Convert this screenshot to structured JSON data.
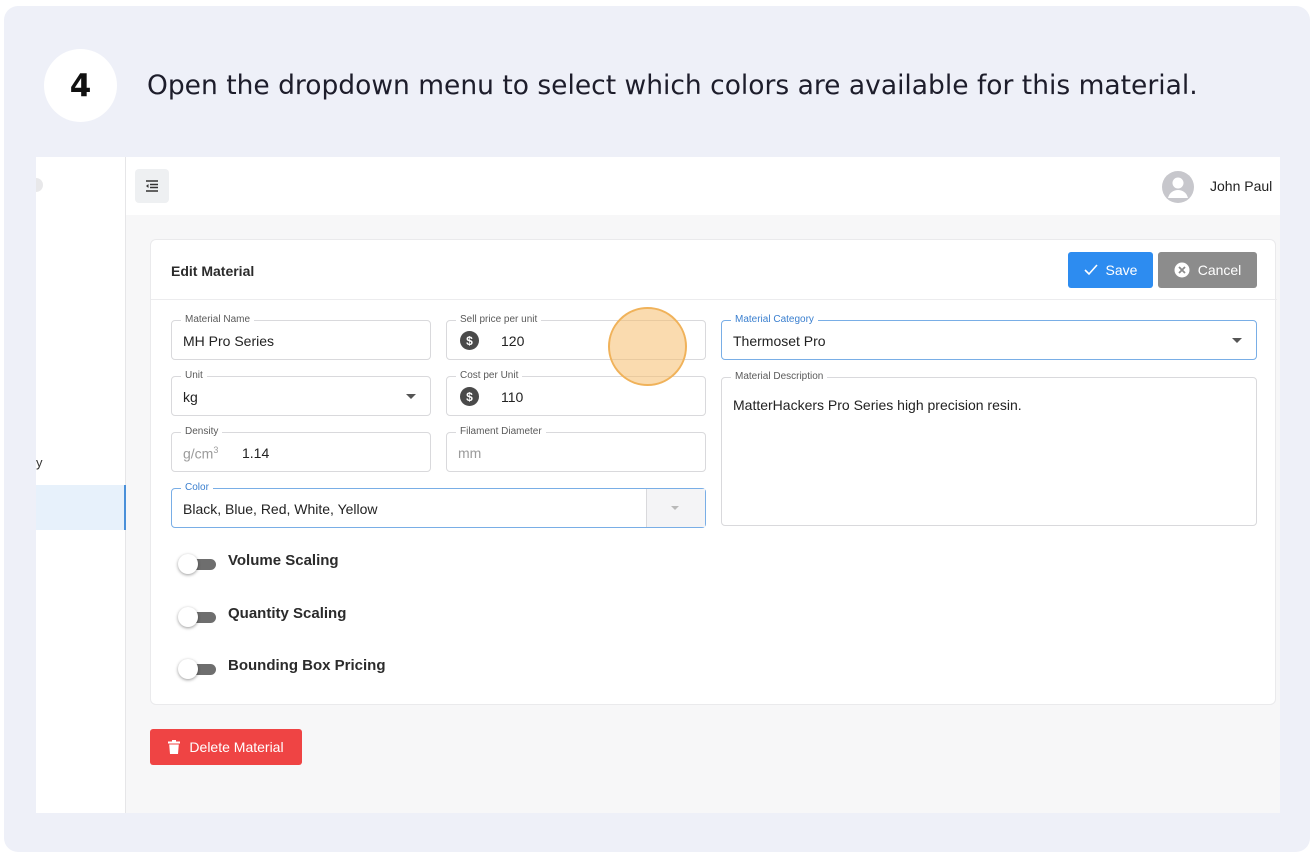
{
  "step": {
    "number": "4",
    "instruction": "Open the dropdown menu to select which colors are available for this material."
  },
  "sidebar": {
    "fragment_text": "y"
  },
  "topbar": {
    "user_name": "John Paul"
  },
  "card": {
    "title": "Edit Material",
    "save_label": "Save",
    "cancel_label": "Cancel"
  },
  "form": {
    "material_name": {
      "label": "Material Name",
      "value": "MH Pro Series"
    },
    "sell_price": {
      "label": "Sell price per unit",
      "value": "120"
    },
    "material_category": {
      "label": "Material Category",
      "value": "Thermoset Pro"
    },
    "unit": {
      "label": "Unit",
      "value": "kg"
    },
    "cost_per_unit": {
      "label": "Cost per Unit",
      "value": "110"
    },
    "material_description": {
      "label": "Material Description",
      "value": "MatterHackers Pro Series high precision resin."
    },
    "density": {
      "label": "Density",
      "unit": "g/cm",
      "unit_sup": "3",
      "value": "1.14"
    },
    "filament_diameter": {
      "label": "Filament Diameter",
      "placeholder": "mm"
    },
    "color": {
      "label": "Color",
      "value": "Black, Blue, Red, White, Yellow"
    }
  },
  "toggles": [
    {
      "label": "Volume Scaling",
      "checked": false
    },
    {
      "label": "Quantity Scaling",
      "checked": false
    },
    {
      "label": "Bounding Box Pricing",
      "checked": false
    }
  ],
  "delete_label": "Delete Material",
  "colors": {
    "primary": "#2d8cf0",
    "cancel": "#8c8c8c",
    "danger": "#ef4444",
    "highlight": "#f0b25a"
  }
}
